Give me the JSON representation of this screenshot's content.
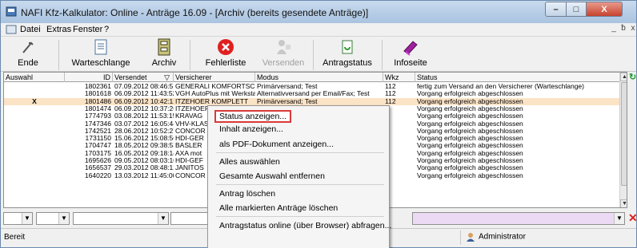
{
  "window": {
    "title": "NAFI Kfz-Kalkulator: Online - Anträge 16.09 - [Archiv (bereits gesendete Anträge)]",
    "controls": {
      "minimize": "–",
      "maximize": "□",
      "close": "X"
    }
  },
  "menubar": {
    "items": [
      "Datei",
      "Extras",
      "Fenster",
      "?"
    ],
    "mdi": [
      "_",
      "ƀ",
      "x"
    ]
  },
  "toolbar": {
    "buttons": [
      {
        "label": "Ende",
        "icon": "exit-icon",
        "enabled": true
      },
      {
        "label": "Warteschlange",
        "icon": "queue-icon",
        "enabled": true
      },
      {
        "label": "Archiv",
        "icon": "archive-icon",
        "enabled": true
      },
      {
        "label": "Fehlerliste",
        "icon": "error-icon",
        "enabled": true
      },
      {
        "label": "Versenden",
        "icon": "send-icon",
        "enabled": false
      },
      {
        "label": "Antragstatus",
        "icon": "status-icon",
        "enabled": true
      },
      {
        "label": "Infoseite",
        "icon": "info-icon",
        "enabled": true
      }
    ]
  },
  "table": {
    "columns": [
      "Auswahl",
      "ID",
      "Versendet",
      "Versicherer",
      "Modus",
      "Wkz",
      "Status"
    ],
    "sort_indicator": "▽",
    "rows": [
      {
        "sel": "",
        "id": "1802361",
        "versendet": "07.09.2012 08:46:51",
        "versicherer": "GENERALI KOMFORTSCH",
        "modus": "Primärversand; Test",
        "wkz": "112",
        "status": "fertig zum Versand an den Versicherer (Warteschlange)"
      },
      {
        "sel": "",
        "id": "1801618",
        "versendet": "06.09.2012 11:43:52",
        "versicherer": "VGH AutoPlus mit Werksta",
        "modus": "Alternativversand per Email/Fax; Test",
        "wkz": "112",
        "status": "Vorgang erfolgreich abgeschlossen"
      },
      {
        "sel": "X",
        "id": "1801486",
        "versendet": "06.09.2012 10:42:12",
        "versicherer": "ITZEHOER KOMPLETT",
        "modus": "Primärversand; Test",
        "wkz": "112",
        "status": "Vorgang erfolgreich abgeschlossen"
      },
      {
        "sel": "",
        "id": "1801474",
        "versendet": "06.09.2012 10:37:26",
        "versicherer": "ITZEHOER",
        "modus": "",
        "wkz": "",
        "status": "Vorgang erfolgreich abgeschlossen"
      },
      {
        "sel": "",
        "id": "1774793",
        "versendet": "03.08.2012 11:53:15",
        "versicherer": "KRAVAG",
        "modus": "",
        "wkz": "",
        "status": "Vorgang erfolgreich abgeschlossen"
      },
      {
        "sel": "",
        "id": "1747346",
        "versendet": "03.07.2012 16:05:44",
        "versicherer": "VHV-KLAS",
        "modus": "",
        "wkz": "",
        "status": "Vorgang erfolgreich abgeschlossen"
      },
      {
        "sel": "",
        "id": "1742521",
        "versendet": "28.06.2012 10:52:27",
        "versicherer": "CONCOR",
        "modus": "",
        "wkz": "",
        "status": "Vorgang erfolgreich abgeschlossen"
      },
      {
        "sel": "",
        "id": "1731150",
        "versendet": "15.06.2012 15:08:56",
        "versicherer": "HDI-GER",
        "modus": "",
        "wkz": "",
        "status": "Vorgang erfolgreich abgeschlossen"
      },
      {
        "sel": "",
        "id": "1704747",
        "versendet": "18.05.2012 09:38:53",
        "versicherer": "BASLER",
        "modus": "",
        "wkz": "",
        "status": "Vorgang erfolgreich abgeschlossen"
      },
      {
        "sel": "",
        "id": "1703175",
        "versendet": "16.05.2012 09:18:14",
        "versicherer": "AXA mot",
        "modus": "",
        "wkz": "",
        "status": "Vorgang erfolgreich abgeschlossen"
      },
      {
        "sel": "",
        "id": "1695626",
        "versendet": "09.05.2012 08:03:10",
        "versicherer": "HDI-GEF",
        "modus": "",
        "wkz": "",
        "status": "Vorgang erfolgreich abgeschlossen"
      },
      {
        "sel": "",
        "id": "1656537",
        "versendet": "29.03.2012 08:48:12",
        "versicherer": "JANITOS",
        "modus": "",
        "wkz": "",
        "status": "Vorgang erfolgreich abgeschlossen"
      },
      {
        "sel": "",
        "id": "1640220",
        "versendet": "13.03.2012 11:45:00",
        "versicherer": "CONCOR",
        "modus": "",
        "wkz": "",
        "status": "Vorgang erfolgreich abgeschlossen"
      }
    ]
  },
  "context_menu": {
    "items": [
      "Status anzeigen...",
      "Inhalt anzeigen...",
      "als PDF-Dokument anzeigen...",
      "Alles auswählen",
      "Gesamte Auswahl entfernen",
      "Antrag löschen",
      "Alle markierten Anträge löschen",
      "Antragstatus online (über Browser) abfragen..."
    ],
    "highlighted_index": 0
  },
  "statusbar": {
    "text": "Bereit",
    "user": "Administrator"
  },
  "colors": {
    "selected_row": "#fbe3c6",
    "highlight_border": "#d83a3a",
    "filter_lilac": "#ecd9f3"
  }
}
